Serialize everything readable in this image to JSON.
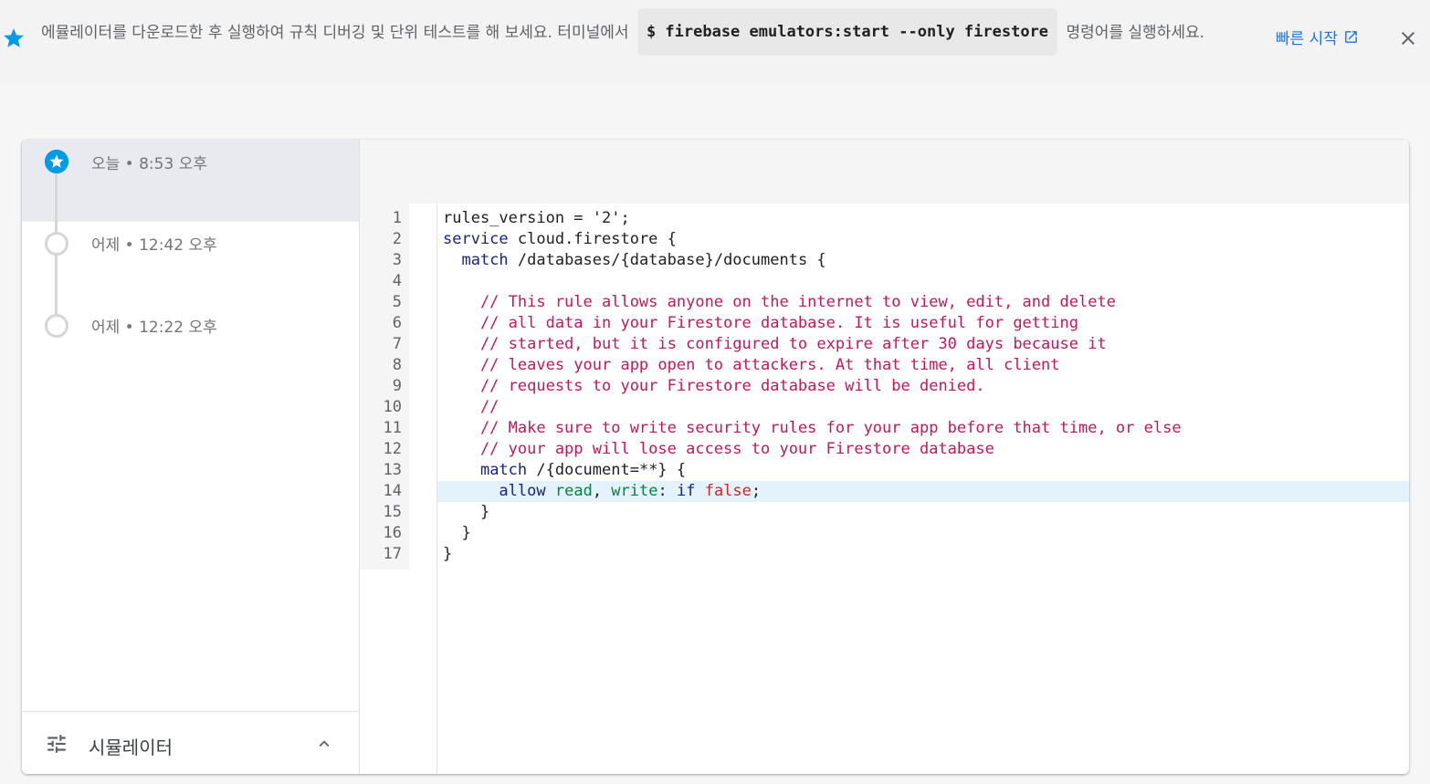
{
  "banner": {
    "text_before": "에뮬레이터를 다운로드한 후 실행하여 규칙 디버깅 및 단위 테스트를 해 보세요. 터미널에서",
    "command": "$ firebase emulators:start --only firestore",
    "text_after": "명령어를 실행하세요.",
    "link_label": "빠른 시작",
    "icons": {
      "lead": "star-icon",
      "link": "open-in-new-icon",
      "close": "close-icon"
    }
  },
  "history": [
    {
      "label": "오늘 • 8:53 오후",
      "selected": true
    },
    {
      "label": "어제 • 12:42 오후",
      "selected": false
    },
    {
      "label": "어제 • 12:22 오후",
      "selected": false
    }
  ],
  "simulator": {
    "label": "시뮬레이터",
    "icons": {
      "lead": "tune-icon",
      "toggle": "chevron-up-icon"
    }
  },
  "editor": {
    "line_numbers": [
      "1",
      "2",
      "3",
      "4",
      "5",
      "6",
      "7",
      "8",
      "9",
      "10",
      "11",
      "12",
      "13",
      "14",
      "15",
      "16",
      "17"
    ],
    "highlighted_line": 14,
    "lines": [
      [
        {
          "t": "rules_version = '2';",
          "c": ""
        }
      ],
      [
        {
          "t": "service",
          "c": "kw"
        },
        {
          "t": " cloud.firestore {",
          "c": ""
        }
      ],
      [
        {
          "t": "  ",
          "c": ""
        },
        {
          "t": "match",
          "c": "kw"
        },
        {
          "t": " /databases/{database}/documents {",
          "c": ""
        }
      ],
      [
        {
          "t": "",
          "c": ""
        }
      ],
      [
        {
          "t": "    // This rule allows anyone on the internet to view, edit, and delete",
          "c": "cm"
        }
      ],
      [
        {
          "t": "    // all data in your Firestore database. It is useful for getting",
          "c": "cm"
        }
      ],
      [
        {
          "t": "    // started, but it is configured to expire after 30 days because it",
          "c": "cm"
        }
      ],
      [
        {
          "t": "    // leaves your app open to attackers. At that time, all client",
          "c": "cm"
        }
      ],
      [
        {
          "t": "    // requests to your Firestore database will be denied.",
          "c": "cm"
        }
      ],
      [
        {
          "t": "    //",
          "c": "cm"
        }
      ],
      [
        {
          "t": "    // Make sure to write security rules for your app before that time, or else",
          "c": "cm"
        }
      ],
      [
        {
          "t": "    // your app will lose access to your Firestore database",
          "c": "cm"
        }
      ],
      [
        {
          "t": "    ",
          "c": ""
        },
        {
          "t": "match",
          "c": "kw"
        },
        {
          "t": " /{document=**} {",
          "c": ""
        }
      ],
      [
        {
          "t": "      ",
          "c": ""
        },
        {
          "t": "allow",
          "c": "kw"
        },
        {
          "t": " ",
          "c": ""
        },
        {
          "t": "read",
          "c": "grn"
        },
        {
          "t": ", ",
          "c": ""
        },
        {
          "t": "write",
          "c": "grn"
        },
        {
          "t": ": ",
          "c": ""
        },
        {
          "t": "if",
          "c": "kw"
        },
        {
          "t": " ",
          "c": ""
        },
        {
          "t": "false",
          "c": "red"
        },
        {
          "t": ";",
          "c": ""
        }
      ],
      [
        {
          "t": "    }",
          "c": ""
        }
      ],
      [
        {
          "t": "  }",
          "c": ""
        }
      ],
      [
        {
          "t": "}",
          "c": ""
        }
      ]
    ]
  },
  "colors": {
    "accent_blue": "#039be5",
    "link_blue": "#1a73e8",
    "keyword": "#1a237e",
    "comment": "#c2185b",
    "permission": "#0b8043",
    "boolean": "#c62828",
    "highlight": "#e3f2fb"
  }
}
